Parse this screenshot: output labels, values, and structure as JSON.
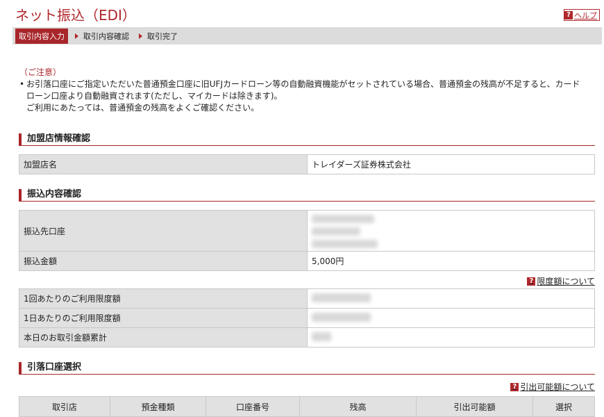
{
  "header": {
    "title": "ネット振込（EDI）",
    "help_label": "ヘルプ"
  },
  "steps": [
    {
      "label": "取引内容入力"
    },
    {
      "label": "取引内容確認"
    },
    {
      "label": "取引完了"
    }
  ],
  "notice": {
    "heading": "（ご注意）",
    "lines": [
      "お引落口座にご指定いただいた普通預金口座に旧UFJカードローン等の自動融資機能がセットされている場合、普通預金の残高が不足すると、カード",
      "ローン口座より自動融資されます(ただし、マイカードは除きます)。",
      "ご利用にあたっては、普通預金の残高をよくご確認ください。"
    ]
  },
  "merchant": {
    "heading": "加盟店情報確認",
    "rows": [
      {
        "label": "加盟店名",
        "value": "トレイダーズ証券株式会社"
      }
    ]
  },
  "transfer": {
    "heading": "振込内容確認",
    "dest_label": "振込先口座",
    "amount_label": "振込金額",
    "amount_value": "5,000円",
    "limit_link": "限度額について",
    "limits": [
      {
        "label": "1回あたりのご利用限度額"
      },
      {
        "label": "1日あたりのご利用限度額"
      },
      {
        "label": "本日のお取引金額累計"
      }
    ]
  },
  "debit": {
    "heading": "引落口座選択",
    "available_link": "引出可能額について",
    "columns": [
      "取引店",
      "預金種類",
      "口座番号",
      "残高",
      "引出可能額",
      "選択"
    ]
  }
}
